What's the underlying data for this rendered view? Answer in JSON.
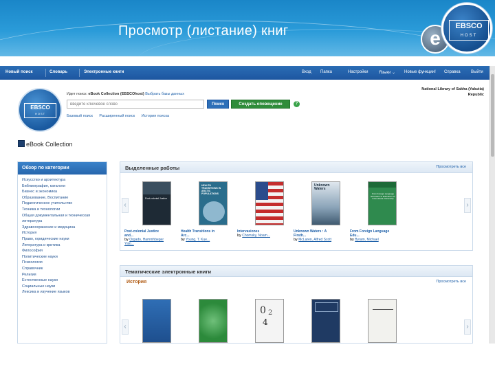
{
  "slide": {
    "title": "Просмотр (листание) книг",
    "logo_text": "EBSCO",
    "logo_sub": "HOST",
    "e_badge": "e"
  },
  "nav": {
    "left": [
      "Новый поиск",
      "Словарь",
      "Электронные книги"
    ],
    "right": [
      "Вход",
      "Папка",
      "Настройки",
      "Языки ⌄",
      "Новые функции!",
      "Справка",
      "Выйти"
    ]
  },
  "search": {
    "logo_text": "EBSCO",
    "logo_sub": "HOST",
    "searching_prefix": "Идет поиск:",
    "searching_db": "eBook Collection (EBSCOhost)",
    "choose_db": "Выбрать базы данных",
    "placeholder": "введите ключевое слово",
    "search_button": "Поиск",
    "alert_button": "Создать оповещение",
    "help": "?",
    "links": [
      "Базовый поиск",
      "Расширенный поиск",
      "История поиска"
    ]
  },
  "library": "National Library of Sakha (Yakutia) Republic",
  "collection": {
    "title": "eBook Collection"
  },
  "categories": {
    "header": "Обзор по категории",
    "items": [
      "Искусство и архитектура",
      "Библиография, каталоги",
      "Бизнес и экономика",
      "Образование, Воспитание",
      "Педагогическое учительство",
      "Техника и технологии",
      "Общая документальная и техническая литература",
      "Здравоохранение и медицина",
      "История",
      "Право, юридические науки",
      "Литература и критика",
      "Философия",
      "Политические науки",
      "Психология",
      "Справочник",
      "Религия",
      "Естественные науки",
      "Социальные науки",
      "Лексика и изучение языков"
    ]
  },
  "featured": {
    "title": "Выделенные работы",
    "view_all": "Просмотреть все",
    "books": [
      {
        "title": "Post-colonial Justice and...",
        "by": "by",
        "author": "Orgado, Hammhbeger Yalo..."
      },
      {
        "title": "Health Transitions in Arc...",
        "by": "by",
        "author": "Young, T. Kue..."
      },
      {
        "title": "Intervasiones",
        "by": "by",
        "author": "Chomsky, Noam..."
      },
      {
        "title": "Unknown Waters : A Firsth...",
        "by": "by",
        "author": "McLaren, Alfred Scott"
      },
      {
        "title": "From Foreign Language Edu...",
        "by": "by",
        "author": "Byram, Michael"
      }
    ],
    "cover_texts": [
      "Post-colonial Justice",
      "HEALTH TRANSITIONS IN ARCTIC POPULATIONS",
      "",
      "Unknown Waters",
      "From Foreign Language Education to Education for Intercultural Citizenship"
    ]
  },
  "thematic": {
    "title": "Тематические электронные книги",
    "view_all": "Просмотреть все",
    "subtitle": "История",
    "view_all_sub": "Просмотреть все"
  },
  "colors": {
    "nav_blue": "#1d56a0",
    "link_blue": "#1d5fa8",
    "accent_green": "#2f8c3a",
    "history_orange": "#b05a12"
  }
}
